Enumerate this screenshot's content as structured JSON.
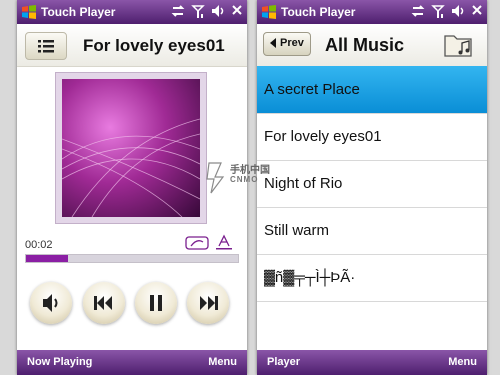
{
  "left": {
    "app_title": "Touch Player",
    "now_playing_title": "For lovely eyes01",
    "time": "00:02",
    "progress": 0.2,
    "soft_left": "Now Playing",
    "soft_right": "Menu"
  },
  "right": {
    "app_title": "Touch Player",
    "prev_label": "Prev",
    "list_title": "All Music",
    "tracks": [
      {
        "title": "A secret Place",
        "selected": true
      },
      {
        "title": "For lovely eyes01",
        "selected": false
      },
      {
        "title": "Night of Rio",
        "selected": false
      },
      {
        "title": "Still warm",
        "selected": false
      },
      {
        "title": "▓ñ▓╤┬Ì┼ÞÃ·",
        "selected": false
      }
    ],
    "soft_left": "Player",
    "soft_right": "Menu"
  },
  "watermark": {
    "cn": "手机中国",
    "en": "CNMO"
  },
  "colors": {
    "titlebar": "#6a3a8c",
    "selection": "#1ea3e6",
    "progress": "#8b1fa4"
  }
}
